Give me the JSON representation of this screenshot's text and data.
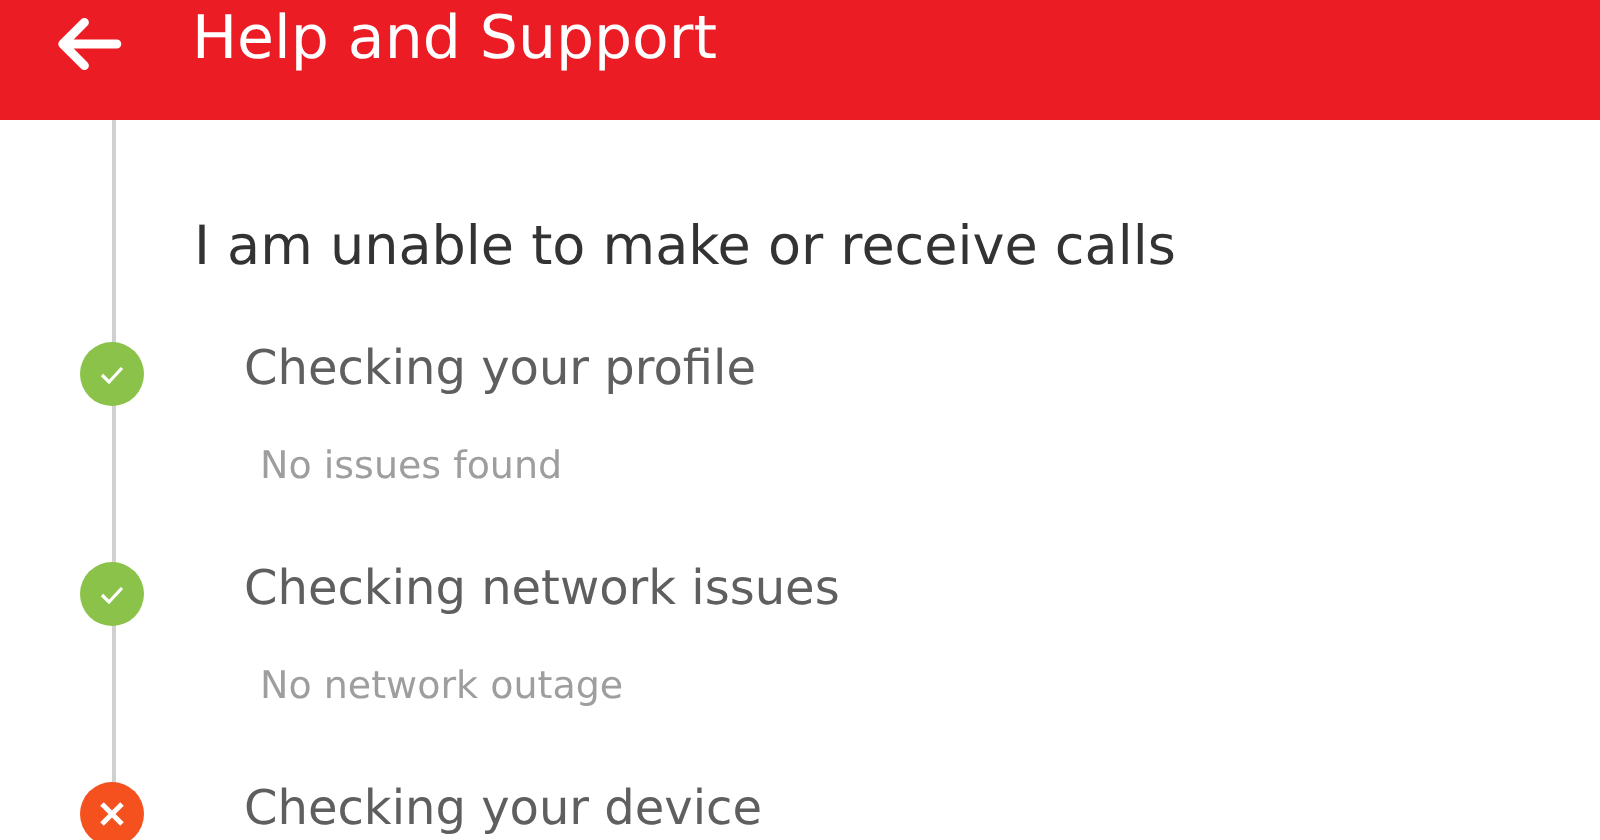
{
  "header": {
    "title": "Help and Support"
  },
  "question": "I am unable to make or receive calls",
  "steps": [
    {
      "title": "Checking your profile",
      "passed": true,
      "detail": "No issues found"
    },
    {
      "title": "Checking network issues",
      "passed": true,
      "detail": "No network outage"
    },
    {
      "title": "Checking your device",
      "passed": false
    }
  ]
}
